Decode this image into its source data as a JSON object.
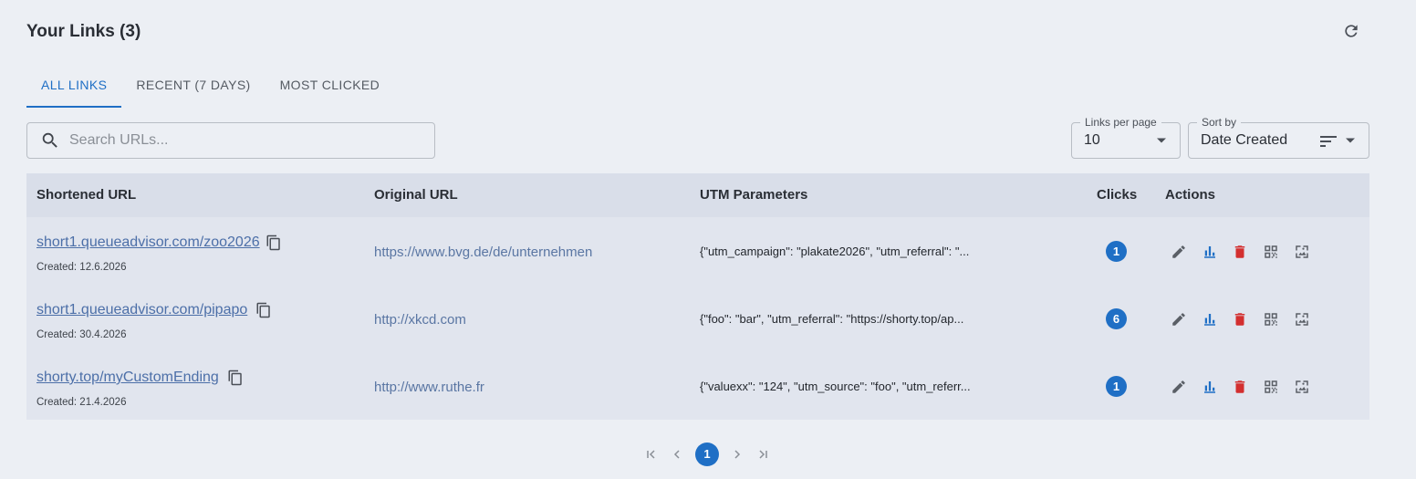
{
  "header": {
    "title": "Your Links (3)",
    "refresh_icon": "refresh-icon"
  },
  "tabs": [
    {
      "label": "ALL LINKS",
      "active": true
    },
    {
      "label": "RECENT (7 DAYS)",
      "active": false
    },
    {
      "label": "MOST CLICKED",
      "active": false
    }
  ],
  "search": {
    "placeholder": "Search URLs...",
    "value": ""
  },
  "links_per_page": {
    "legend": "Links per page",
    "value": "10"
  },
  "sort_by": {
    "legend": "Sort by",
    "value": "Date Created"
  },
  "table": {
    "columns": [
      "Shortened URL",
      "Original URL",
      "UTM Parameters",
      "Clicks",
      "Actions"
    ],
    "rows": [
      {
        "short_url": "short1.queueadvisor.com/zoo2026",
        "created": "Created: 12.6.2026",
        "original_url": "https://www.bvg.de/de/unternehmen",
        "utm": "{\"utm_campaign\": \"plakate2026\", \"utm_referral\": \"...",
        "clicks": "1"
      },
      {
        "short_url": "short1.queueadvisor.com/pipapo",
        "created": "Created: 30.4.2026",
        "original_url": "http://xkcd.com",
        "utm": "{\"foo\": \"bar\", \"utm_referral\": \"https://shorty.top/ap...",
        "clicks": "6"
      },
      {
        "short_url": "shorty.top/myCustomEnding",
        "created": "Created: 21.4.2026",
        "original_url": "http://www.ruthe.fr",
        "utm": "{\"valuexx\": \"124\", \"utm_source\": \"foo\", \"utm_referr...",
        "clicks": "1"
      }
    ]
  },
  "pagination": {
    "current_page": "1"
  },
  "colors": {
    "accent": "#1f6fc5",
    "delete": "#d32f2f",
    "background": "#eceff4"
  }
}
